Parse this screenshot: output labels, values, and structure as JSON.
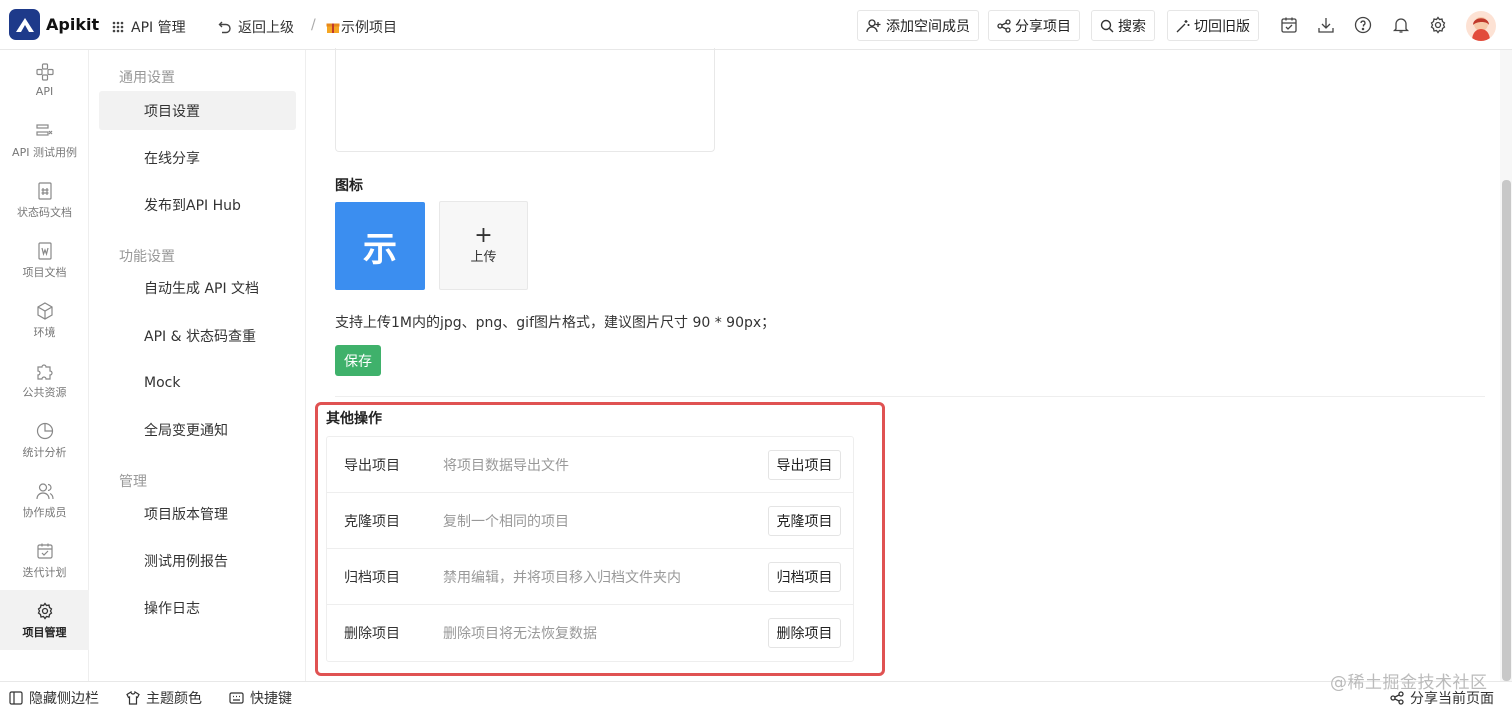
{
  "header": {
    "brand": "Apikit",
    "nav_api": "API 管理",
    "back": "返回上级",
    "separator": "/",
    "project_name": "示例项目",
    "add_member": "添加空间成员",
    "share_project": "分享项目",
    "search": "搜索",
    "switch_old": "切回旧版"
  },
  "rail": {
    "items": [
      {
        "label": "API",
        "icon": "api-icon"
      },
      {
        "label": "API 测试用例",
        "icon": "test-case-icon"
      },
      {
        "label": "状态码文档",
        "icon": "status-code-doc-icon"
      },
      {
        "label": "项目文档",
        "icon": "project-doc-icon"
      },
      {
        "label": "环境",
        "icon": "environment-icon"
      },
      {
        "label": "公共资源",
        "icon": "puzzle-icon"
      },
      {
        "label": "统计分析",
        "icon": "pie-chart-icon"
      },
      {
        "label": "协作成员",
        "icon": "members-icon"
      },
      {
        "label": "迭代计划",
        "icon": "calendar-icon"
      },
      {
        "label": "项目管理",
        "icon": "gear-icon"
      }
    ]
  },
  "menu": {
    "group_general": "通用设置",
    "item_project_settings": "项目设置",
    "item_online_share": "在线分享",
    "item_publish_hub": "发布到API Hub",
    "group_features": "功能设置",
    "item_auto_doc": "自动生成 API 文档",
    "item_dedupe": "API & 状态码查重",
    "item_mock": "Mock",
    "item_notify": "全局变更通知",
    "group_manage": "管理",
    "item_versions": "项目版本管理",
    "item_reports": "测试用例报告",
    "item_logs": "操作日志"
  },
  "main": {
    "icon_label": "图标",
    "icon_char": "示",
    "upload_plus": "+",
    "upload_label": "上传",
    "upload_hint": "支持上传1M内的jpg、png、gif图片格式，建议图片尺寸 90 * 90px；",
    "save": "保存",
    "other_ops_title": "其他操作",
    "ops": [
      {
        "name": "导出项目",
        "desc": "将项目数据导出文件",
        "button": "导出项目"
      },
      {
        "name": "克隆项目",
        "desc": "复制一个相同的项目",
        "button": "克隆项目"
      },
      {
        "name": "归档项目",
        "desc": "禁用编辑，并将项目移入归档文件夹内",
        "button": "归档项目"
      },
      {
        "name": "删除项目",
        "desc": "删除项目将无法恢复数据",
        "button": "删除项目"
      }
    ]
  },
  "footer": {
    "hide_sidebar": "隐藏侧边栏",
    "theme_color": "主题颜色",
    "shortcuts": "快捷键",
    "share_page": "分享当前页面",
    "watermark": "@稀土掘金技术社区"
  },
  "colors": {
    "brand": "#1e3a8a",
    "icon_tile": "#3b8ef0",
    "save": "#3fb16b",
    "highlight": "#e05252"
  }
}
